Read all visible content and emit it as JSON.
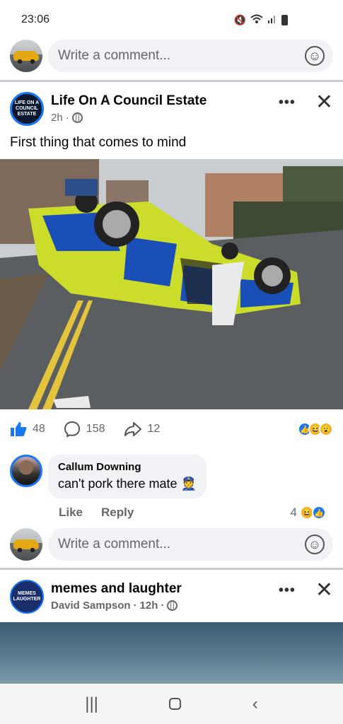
{
  "status_bar": {
    "time": "23:06",
    "icons": [
      "mute-icon",
      "wifi-icon",
      "signal-icon",
      "battery-icon"
    ]
  },
  "top_comment": {
    "placeholder": "Write a comment..."
  },
  "post1": {
    "page_name": "Life On A Council Estate",
    "logo_text": "LIFE ON A COUNCIL ESTATE",
    "time": "2h",
    "audience_icon": "globe-icon",
    "caption": "First thing that comes to mind",
    "stats": {
      "likes": "48",
      "comments": "158",
      "shares": "12"
    },
    "reaction_icons": [
      "like-reaction",
      "haha-reaction",
      "wow-reaction"
    ],
    "comment": {
      "author": "Callum Downing",
      "text": "can't pork there mate 👮",
      "like_label": "Like",
      "reply_label": "Reply",
      "reaction_count": "4"
    },
    "comment_input": {
      "placeholder": "Write a comment..."
    }
  },
  "post2": {
    "page_name": "memes and laughter",
    "logo_text": "MEMES LAUGHTER",
    "author": "David Sampson",
    "time": "12h",
    "audience_icon": "globe-icon"
  },
  "colors": {
    "accent": "#1877f2",
    "input_bg": "#f0f2f5",
    "secondary_text": "#65676b"
  },
  "nav_bar": {
    "icons": [
      "recent-apps-icon",
      "home-icon",
      "back-icon"
    ]
  }
}
